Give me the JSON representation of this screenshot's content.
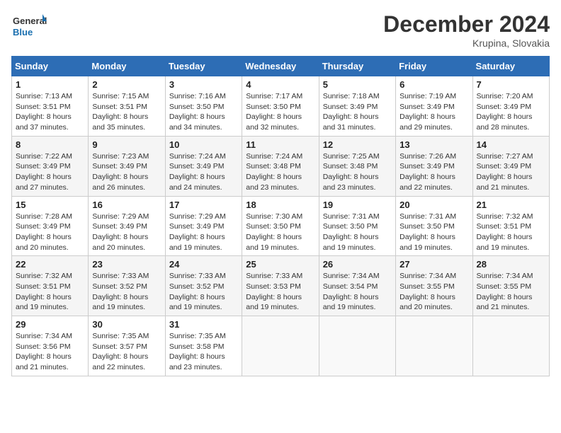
{
  "header": {
    "logo_line1": "General",
    "logo_line2": "Blue",
    "month": "December 2024",
    "location": "Krupina, Slovakia"
  },
  "days_of_week": [
    "Sunday",
    "Monday",
    "Tuesday",
    "Wednesday",
    "Thursday",
    "Friday",
    "Saturday"
  ],
  "weeks": [
    [
      {
        "day": 1,
        "sunrise": "7:13 AM",
        "sunset": "3:51 PM",
        "daylight": "8 hours and 37 minutes."
      },
      {
        "day": 2,
        "sunrise": "7:15 AM",
        "sunset": "3:51 PM",
        "daylight": "8 hours and 35 minutes."
      },
      {
        "day": 3,
        "sunrise": "7:16 AM",
        "sunset": "3:50 PM",
        "daylight": "8 hours and 34 minutes."
      },
      {
        "day": 4,
        "sunrise": "7:17 AM",
        "sunset": "3:50 PM",
        "daylight": "8 hours and 32 minutes."
      },
      {
        "day": 5,
        "sunrise": "7:18 AM",
        "sunset": "3:49 PM",
        "daylight": "8 hours and 31 minutes."
      },
      {
        "day": 6,
        "sunrise": "7:19 AM",
        "sunset": "3:49 PM",
        "daylight": "8 hours and 29 minutes."
      },
      {
        "day": 7,
        "sunrise": "7:20 AM",
        "sunset": "3:49 PM",
        "daylight": "8 hours and 28 minutes."
      }
    ],
    [
      {
        "day": 8,
        "sunrise": "7:22 AM",
        "sunset": "3:49 PM",
        "daylight": "8 hours and 27 minutes."
      },
      {
        "day": 9,
        "sunrise": "7:23 AM",
        "sunset": "3:49 PM",
        "daylight": "8 hours and 26 minutes."
      },
      {
        "day": 10,
        "sunrise": "7:24 AM",
        "sunset": "3:49 PM",
        "daylight": "8 hours and 24 minutes."
      },
      {
        "day": 11,
        "sunrise": "7:24 AM",
        "sunset": "3:48 PM",
        "daylight": "8 hours and 23 minutes."
      },
      {
        "day": 12,
        "sunrise": "7:25 AM",
        "sunset": "3:48 PM",
        "daylight": "8 hours and 23 minutes."
      },
      {
        "day": 13,
        "sunrise": "7:26 AM",
        "sunset": "3:49 PM",
        "daylight": "8 hours and 22 minutes."
      },
      {
        "day": 14,
        "sunrise": "7:27 AM",
        "sunset": "3:49 PM",
        "daylight": "8 hours and 21 minutes."
      }
    ],
    [
      {
        "day": 15,
        "sunrise": "7:28 AM",
        "sunset": "3:49 PM",
        "daylight": "8 hours and 20 minutes."
      },
      {
        "day": 16,
        "sunrise": "7:29 AM",
        "sunset": "3:49 PM",
        "daylight": "8 hours and 20 minutes."
      },
      {
        "day": 17,
        "sunrise": "7:29 AM",
        "sunset": "3:49 PM",
        "daylight": "8 hours and 19 minutes."
      },
      {
        "day": 18,
        "sunrise": "7:30 AM",
        "sunset": "3:50 PM",
        "daylight": "8 hours and 19 minutes."
      },
      {
        "day": 19,
        "sunrise": "7:31 AM",
        "sunset": "3:50 PM",
        "daylight": "8 hours and 19 minutes."
      },
      {
        "day": 20,
        "sunrise": "7:31 AM",
        "sunset": "3:50 PM",
        "daylight": "8 hours and 19 minutes."
      },
      {
        "day": 21,
        "sunrise": "7:32 AM",
        "sunset": "3:51 PM",
        "daylight": "8 hours and 19 minutes."
      }
    ],
    [
      {
        "day": 22,
        "sunrise": "7:32 AM",
        "sunset": "3:51 PM",
        "daylight": "8 hours and 19 minutes."
      },
      {
        "day": 23,
        "sunrise": "7:33 AM",
        "sunset": "3:52 PM",
        "daylight": "8 hours and 19 minutes."
      },
      {
        "day": 24,
        "sunrise": "7:33 AM",
        "sunset": "3:52 PM",
        "daylight": "8 hours and 19 minutes."
      },
      {
        "day": 25,
        "sunrise": "7:33 AM",
        "sunset": "3:53 PM",
        "daylight": "8 hours and 19 minutes."
      },
      {
        "day": 26,
        "sunrise": "7:34 AM",
        "sunset": "3:54 PM",
        "daylight": "8 hours and 19 minutes."
      },
      {
        "day": 27,
        "sunrise": "7:34 AM",
        "sunset": "3:55 PM",
        "daylight": "8 hours and 20 minutes."
      },
      {
        "day": 28,
        "sunrise": "7:34 AM",
        "sunset": "3:55 PM",
        "daylight": "8 hours and 21 minutes."
      }
    ],
    [
      {
        "day": 29,
        "sunrise": "7:34 AM",
        "sunset": "3:56 PM",
        "daylight": "8 hours and 21 minutes."
      },
      {
        "day": 30,
        "sunrise": "7:35 AM",
        "sunset": "3:57 PM",
        "daylight": "8 hours and 22 minutes."
      },
      {
        "day": 31,
        "sunrise": "7:35 AM",
        "sunset": "3:58 PM",
        "daylight": "8 hours and 23 minutes."
      },
      null,
      null,
      null,
      null
    ]
  ]
}
